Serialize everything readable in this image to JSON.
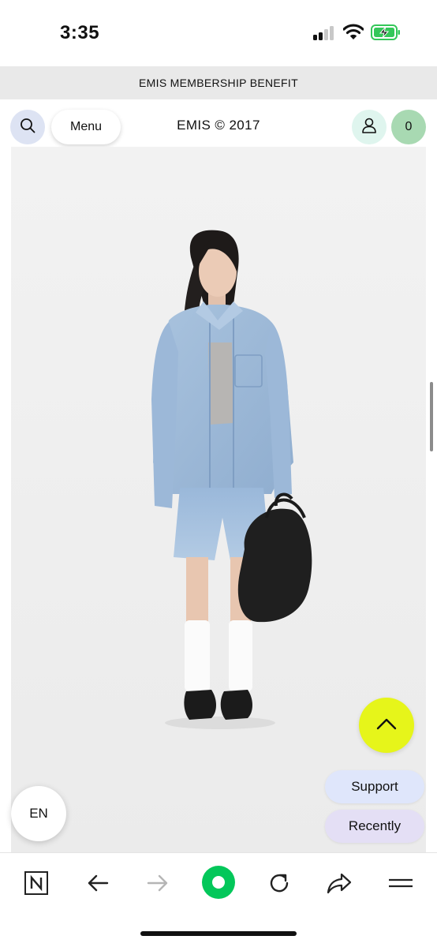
{
  "status_bar": {
    "time": "3:35",
    "icons": [
      "cellular-signal-icon",
      "wifi-icon",
      "battery-charging-icon"
    ],
    "battery_color": "#34c759"
  },
  "banner": {
    "text": "EMIS MEMBERSHIP BENEFIT"
  },
  "header": {
    "search_icon": "search-icon",
    "menu_label": "Menu",
    "brand": "EMIS © 2017",
    "user_icon": "user-icon",
    "cart_count": "0"
  },
  "hero": {
    "image": "model-in-denim-outfit-photo"
  },
  "floating": {
    "top_icon": "chevron-up-icon",
    "language": "EN",
    "support_label": "Support",
    "recently_label": "Recently"
  },
  "colors": {
    "accent_yellow": "#e6f51a",
    "cart_green": "#a8d9b2",
    "search_blue": "#dde3f3",
    "support_blue": "#dfe6fb",
    "recently_lilac": "#e4dff5"
  },
  "browser_bar": {
    "icons": [
      "naver-n-icon",
      "back-arrow-icon",
      "forward-arrow-icon",
      "home-green-circle-icon",
      "reload-icon",
      "share-icon",
      "menu-lines-icon"
    ],
    "home_color": "#03c75a"
  }
}
